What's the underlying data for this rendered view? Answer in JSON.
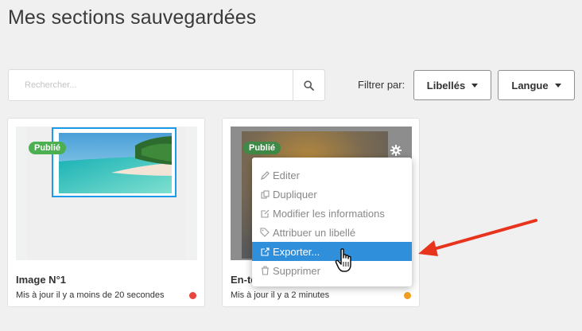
{
  "page": {
    "title": "Mes sections sauvegardées"
  },
  "search": {
    "placeholder": "Rechercher..."
  },
  "filters": {
    "label": "Filtrer par:",
    "labels_button": "Libellés",
    "language_button": "Langue"
  },
  "cards": [
    {
      "badge": "Publié",
      "title": "Image N°1",
      "meta": "Mis à jour il y a moins de 20 secondes",
      "status_color": "#e8453c"
    },
    {
      "badge": "Publié",
      "title": "En-tê",
      "meta": "Mis à jour il y a 2 minutes",
      "status_color": "#f0a020"
    }
  ],
  "context_menu": {
    "items": [
      {
        "label": "Editer",
        "icon": "pencil-icon"
      },
      {
        "label": "Dupliquer",
        "icon": "copy-icon"
      },
      {
        "label": "Modifier les informations",
        "icon": "edit-box-icon"
      },
      {
        "label": "Attribuer un libellé",
        "icon": "tag-icon"
      },
      {
        "label": "Exporter...",
        "icon": "export-icon",
        "active": true
      },
      {
        "label": "Supprimer",
        "icon": "trash-icon"
      }
    ]
  },
  "colors": {
    "accent": "#2f8fdb",
    "badge": "#4caf50",
    "arrow": "#e8341c",
    "selection": "#1e9be8"
  }
}
